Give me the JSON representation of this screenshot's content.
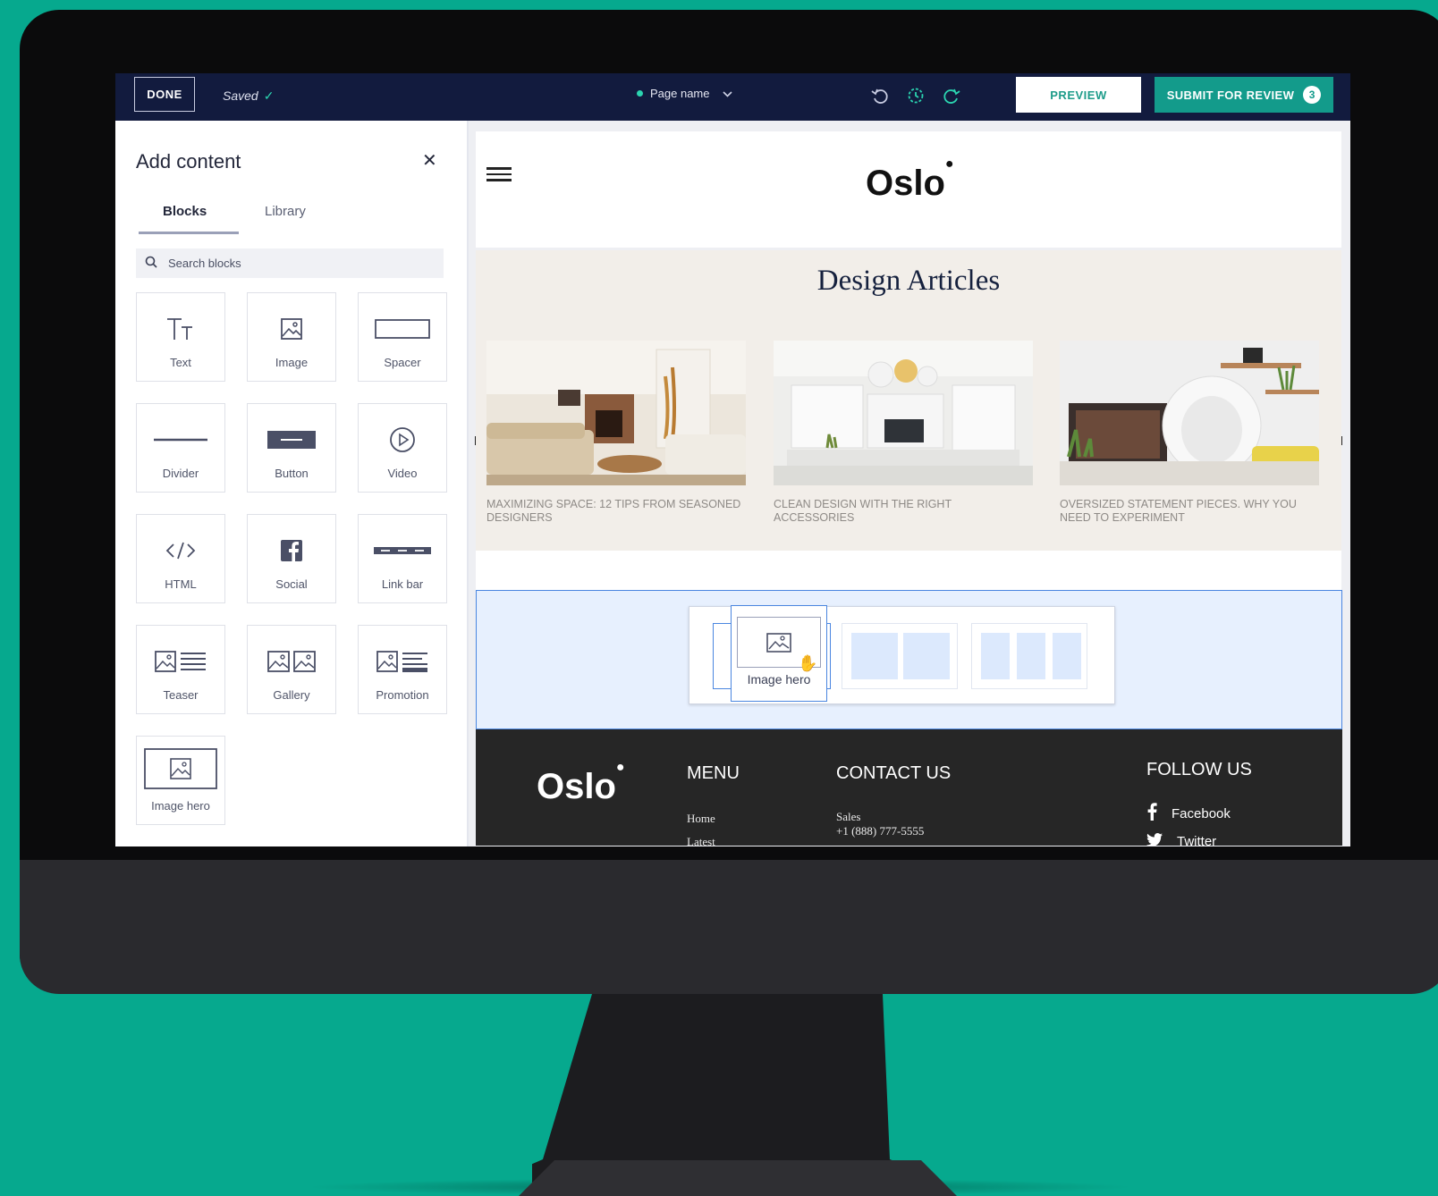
{
  "topbar": {
    "done_label": "DONE",
    "saved_label": "Saved",
    "page_name": "Page name",
    "preview_label": "PREVIEW",
    "submit_label": "SUBMIT FOR REVIEW",
    "submit_count": "3",
    "colors": {
      "bar": "#121b3e",
      "accent": "#139b8b",
      "status": "#2bd4b0"
    }
  },
  "sidebar": {
    "title": "Add content",
    "tabs": [
      {
        "label": "Blocks"
      },
      {
        "label": "Library"
      }
    ],
    "search": {
      "placeholder": "Search blocks"
    },
    "blocks": [
      {
        "label": "Text",
        "icon": "text-icon"
      },
      {
        "label": "Image",
        "icon": "image-icon"
      },
      {
        "label": "Spacer",
        "icon": "spacer-icon"
      },
      {
        "label": "Divider",
        "icon": "divider-icon"
      },
      {
        "label": "Button",
        "icon": "button-icon"
      },
      {
        "label": "Video",
        "icon": "play-icon"
      },
      {
        "label": "HTML",
        "icon": "code-icon"
      },
      {
        "label": "Social",
        "icon": "facebook-icon"
      },
      {
        "label": "Link bar",
        "icon": "link-bar-icon"
      },
      {
        "label": "Teaser",
        "icon": "teaser-icon"
      },
      {
        "label": "Gallery",
        "icon": "gallery-icon"
      },
      {
        "label": "Promotion",
        "icon": "promotion-icon"
      },
      {
        "label": "Image hero",
        "icon": "image-hero-icon"
      }
    ]
  },
  "site": {
    "logo": "Oslo",
    "articles_title": "Design Articles",
    "articles": [
      {
        "caption": "MAXIMIZING SPACE: 12 TIPS FROM SEASONED DESIGNERS"
      },
      {
        "caption": "CLEAN DESIGN WITH THE RIGHT ACCESSORIES"
      },
      {
        "caption": "OVERSIZED STATEMENT PIECES. WHY YOU NEED TO EXPERIMENT"
      }
    ],
    "drag_label": "Image hero",
    "footer": {
      "logo": "Oslo",
      "menu_title": "MENU",
      "menu_items": [
        "Home",
        "Latest"
      ],
      "contact_title": "CONTACT US",
      "contact_label": "Sales",
      "contact_phone": "+1 (888) 777-5555",
      "follow_title": "FOLLOW US",
      "social": [
        "Facebook",
        "Twitter"
      ]
    }
  }
}
